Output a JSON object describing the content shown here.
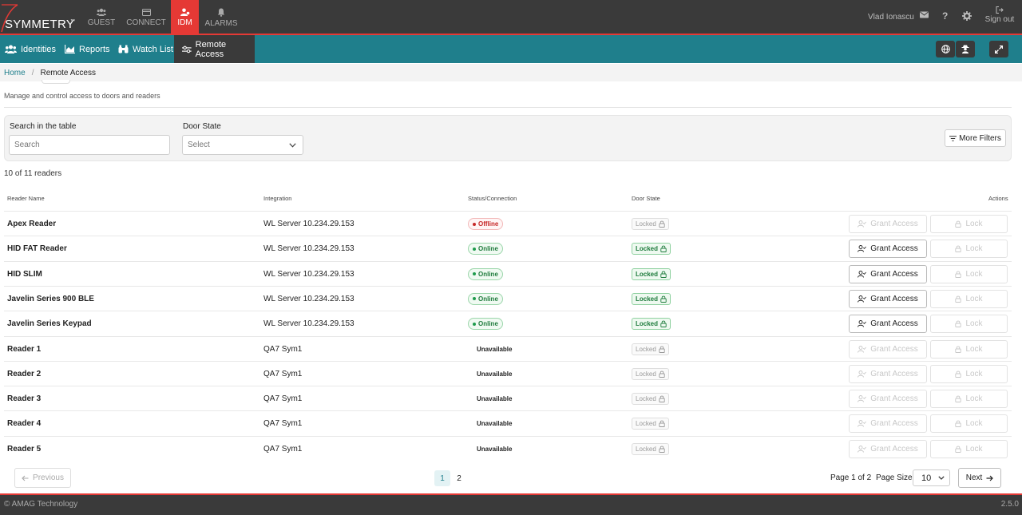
{
  "app": {
    "logo_text": "SYMMETRY",
    "logo_tm": "™"
  },
  "topnav": [
    {
      "label": "GUEST"
    },
    {
      "label": "CONNECT"
    },
    {
      "label": "IDM"
    },
    {
      "label": "ALARMS"
    }
  ],
  "user": {
    "name": "Vlad Ionascu",
    "signout": "Sign out"
  },
  "subnav": [
    {
      "label": "Identities"
    },
    {
      "label": "Reports"
    },
    {
      "label": "Watch List"
    },
    {
      "label": "Remote Access"
    }
  ],
  "breadcrumb": {
    "home": "Home",
    "separator": "/",
    "current": "Remote Access"
  },
  "page": {
    "subtitle": "Manage and control access to doors and readers"
  },
  "filters": {
    "search_label": "Search in the table",
    "search_placeholder": "Search",
    "door_state_label": "Door State",
    "door_state_value": "Select",
    "more_filters": "More Filters"
  },
  "table": {
    "count": "10 of 11 readers",
    "headers": [
      "Reader Name",
      "Integration",
      "Status/Connection",
      "Door State",
      "Actions"
    ],
    "grant_label": "Grant Access",
    "lock_label": "Lock",
    "rows": [
      {
        "name": "Apex Reader",
        "integration": "WL Server 10.234.29.153",
        "status": "Offline",
        "door": "Locked"
      },
      {
        "name": "HID FAT Reader",
        "integration": "WL Server 10.234.29.153",
        "status": "Online",
        "door": "Locked"
      },
      {
        "name": "HID SLIM",
        "integration": "WL Server 10.234.29.153",
        "status": "Online",
        "door": "Locked"
      },
      {
        "name": "Javelin Series 900 BLE",
        "integration": "WL Server 10.234.29.153",
        "status": "Online",
        "door": "Locked"
      },
      {
        "name": "Javelin Series Keypad",
        "integration": "WL Server 10.234.29.153",
        "status": "Online",
        "door": "Locked"
      },
      {
        "name": "Reader 1",
        "integration": "QA7 Sym1",
        "status": "Unavailable",
        "door": "Locked"
      },
      {
        "name": "Reader 2",
        "integration": "QA7 Sym1",
        "status": "Unavailable",
        "door": "Locked"
      },
      {
        "name": "Reader 3",
        "integration": "QA7 Sym1",
        "status": "Unavailable",
        "door": "Locked"
      },
      {
        "name": "Reader 4",
        "integration": "QA7 Sym1",
        "status": "Unavailable",
        "door": "Locked"
      },
      {
        "name": "Reader 5",
        "integration": "QA7 Sym1",
        "status": "Unavailable",
        "door": "Locked"
      }
    ]
  },
  "pagination": {
    "previous": "Previous",
    "next": "Next",
    "pages": [
      "1",
      "2"
    ],
    "page_info": "Page 1 of 2",
    "page_size_label": "Page Size",
    "page_size": "10"
  },
  "footer": {
    "copyright": "© AMAG Technology",
    "version": "2.5.0"
  },
  "colors": {
    "accent": "#e53935",
    "teal": "#1f7f8c",
    "dark": "#3a3a3a",
    "online": "#1e7b3c",
    "offline": "#c62828"
  }
}
